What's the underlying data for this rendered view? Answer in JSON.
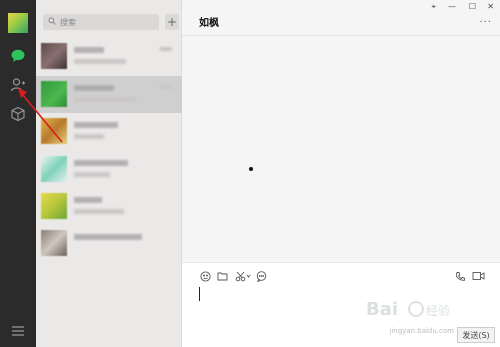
{
  "search": {
    "placeholder": "搜索",
    "add_label": "+"
  },
  "chat": {
    "title": "如枫",
    "more_label": "...",
    "send_label": "发送(S)"
  },
  "window_controls": {
    "pin": "⌖",
    "minimize": "—",
    "maximize": "☐",
    "close": "✕"
  },
  "icons": {
    "chat_icon": "chat-bubble",
    "contacts_icon": "person-add",
    "collections_icon": "cube",
    "menu_icon": "hamburger",
    "emoji_icon": "emoji",
    "folder_icon": "folder",
    "scissors_icon": "scissors",
    "comment_icon": "speech-bubble",
    "phone_icon": "phone",
    "video_icon": "video-camera"
  },
  "contact_list": [
    {
      "id": "c1"
    },
    {
      "id": "c2",
      "selected": true
    },
    {
      "id": "c3"
    },
    {
      "id": "c4"
    },
    {
      "id": "c5"
    },
    {
      "id": "c6"
    }
  ],
  "watermark": {
    "text": "jingyan.baidu.com"
  },
  "colors": {
    "accent_green": "#2fc15c",
    "sidebar_dark": "#2b2b2b",
    "annotation_red": "#d81e1e"
  }
}
